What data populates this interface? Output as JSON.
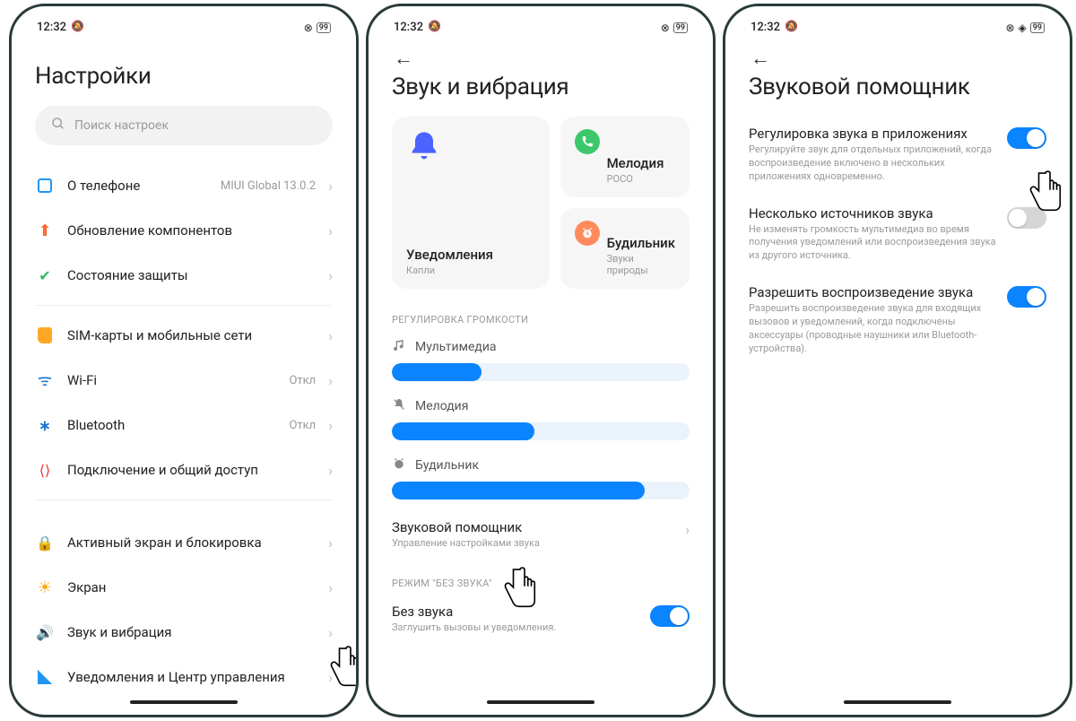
{
  "status": {
    "time": "12:32",
    "battery": "99"
  },
  "screen1": {
    "title": "Настройки",
    "search_placeholder": "Поиск настроек",
    "groups": [
      {
        "items": [
          {
            "icon": "square-blue",
            "label": "О телефоне",
            "value": "MIUI Global 13.0.2"
          },
          {
            "icon": "up-orange",
            "label": "Обновление компонентов"
          },
          {
            "icon": "shield-green",
            "label": "Состояние защиты"
          }
        ]
      },
      {
        "items": [
          {
            "icon": "sim",
            "label": "SIM-карты и мобильные сети"
          },
          {
            "icon": "wifi",
            "label": "Wi-Fi",
            "value": "Откл"
          },
          {
            "icon": "bt",
            "label": "Bluetooth",
            "value": "Откл"
          },
          {
            "icon": "link",
            "label": "Подключение и общий доступ"
          }
        ]
      },
      {
        "items": [
          {
            "icon": "lock",
            "label": "Активный экран и блокировка"
          },
          {
            "icon": "sun",
            "label": "Экран"
          },
          {
            "icon": "speaker",
            "label": "Звук и вибрация"
          },
          {
            "icon": "grid",
            "label": "Уведомления и Центр управления"
          }
        ]
      }
    ]
  },
  "screen2": {
    "title": "Звук и вибрация",
    "cards": {
      "notification": {
        "title": "Уведомления",
        "sub": "Капли"
      },
      "ringtone": {
        "title": "Мелодия",
        "sub": "POCO"
      },
      "alarm": {
        "title": "Будильник",
        "sub": "Звуки природы"
      }
    },
    "volume_header": "РЕГУЛИРОВКА ГРОМКОСТИ",
    "sliders": [
      {
        "icon": "music",
        "label": "Мультимедиа",
        "pct": 30
      },
      {
        "icon": "bell-mute",
        "label": "Мелодия",
        "pct": 48
      },
      {
        "icon": "alarm",
        "label": "Будильник",
        "pct": 85
      }
    ],
    "assistant": {
      "title": "Звуковой помощник",
      "sub": "Управление настройками звука"
    },
    "silent_header": "РЕЖИМ \"БЕЗ ЗВУКА\"",
    "silent": {
      "title": "Без звука",
      "sub": "Заглушить вызовы и уведомления.",
      "on": true
    }
  },
  "screen3": {
    "title": "Звуковой помощник",
    "rows": [
      {
        "title": "Регулировка звука в приложениях",
        "sub": "Регулируйте звук для отдельных приложений, когда воспроизведение включено в нескольких приложениях одновременно.",
        "on": true
      },
      {
        "title": "Несколько источников звука",
        "sub": "Не изменять громкость мультимедиа во время получения уведомлений или воспроизведения звука из другого источника.",
        "on": false
      },
      {
        "title": "Разрешить воспроизведение звука",
        "sub": "Разрешить воспроизведение звука для входящих вызовов и уведомлений, когда подключены аксессуары (проводные наушники или Bluetooth-устройства).",
        "on": true
      }
    ]
  }
}
